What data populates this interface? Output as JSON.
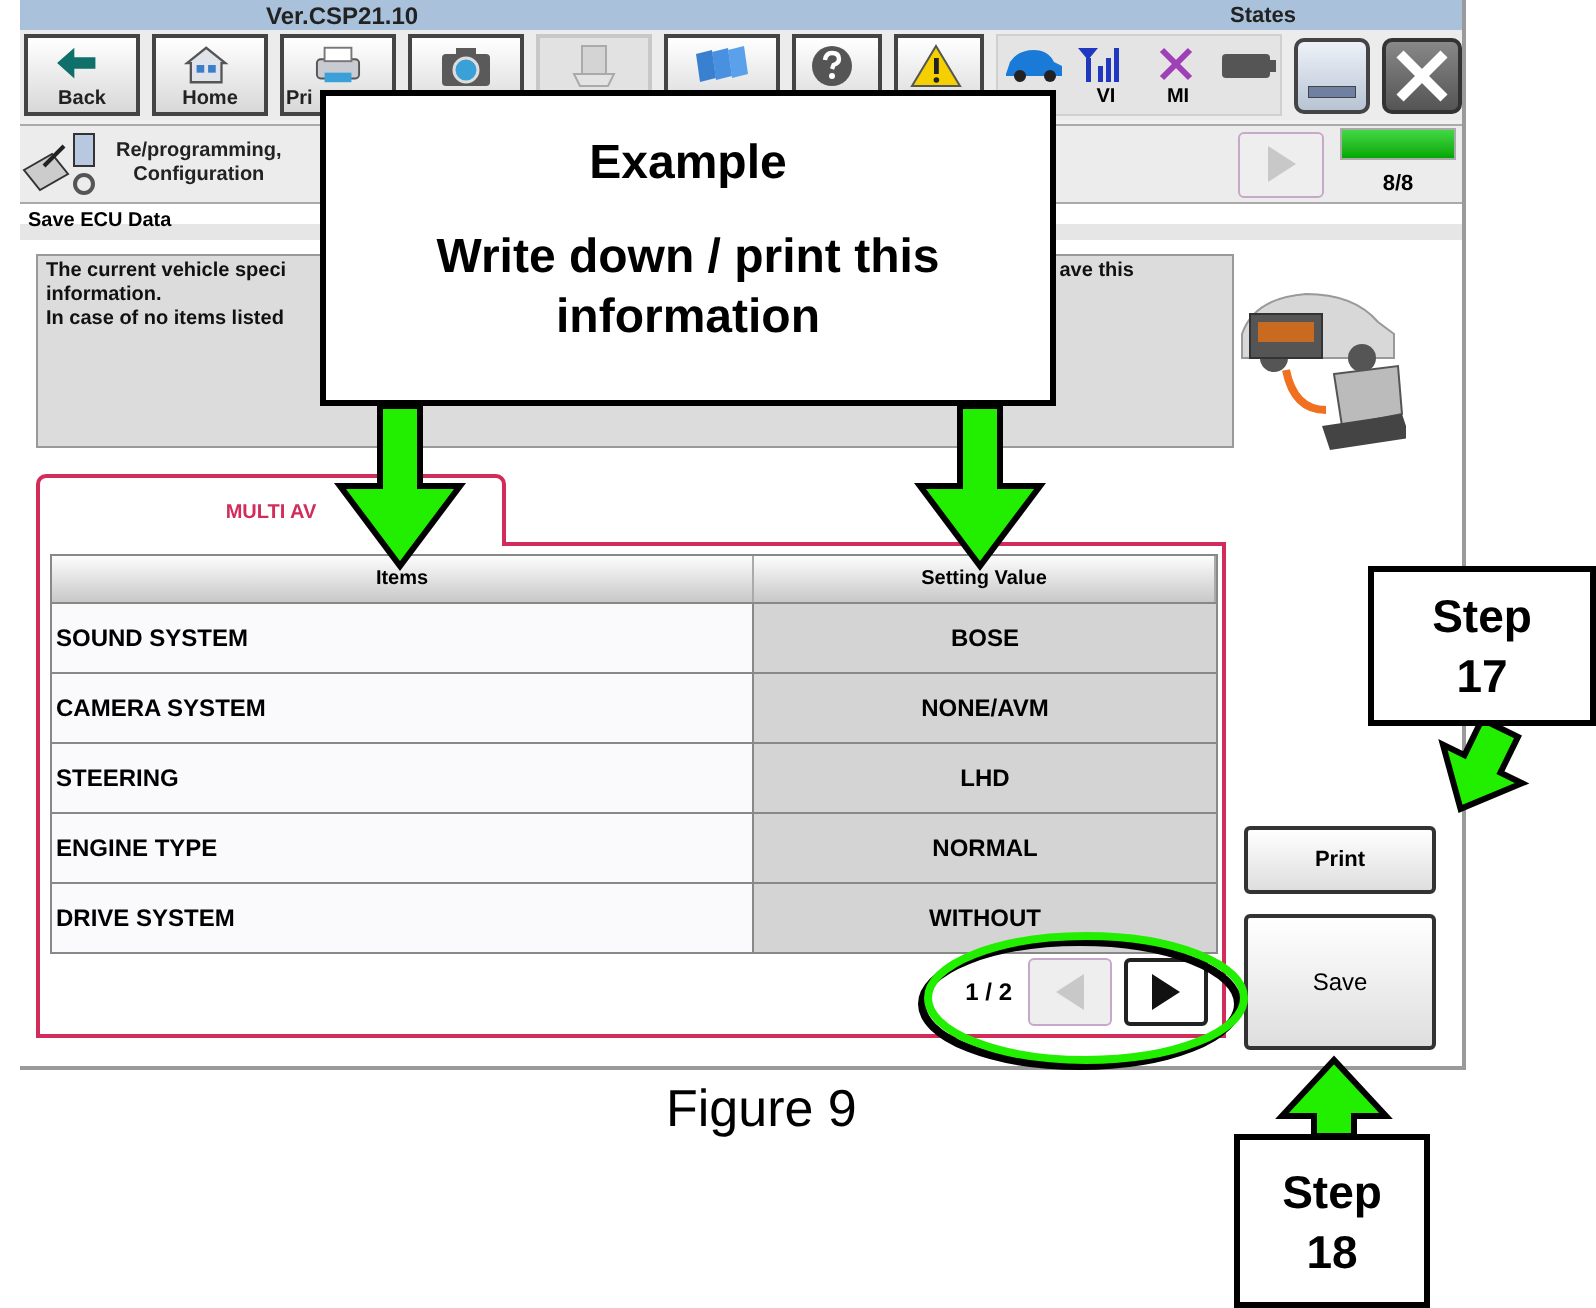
{
  "title_bar": {
    "version": "Ver.CSP21.10",
    "states_label": "States"
  },
  "toolbar": [
    {
      "kind": "back",
      "label": "Back",
      "disabled": false
    },
    {
      "kind": "home",
      "label": "Home",
      "disabled": false
    },
    {
      "kind": "print",
      "label": "Pri",
      "disabled": false
    },
    {
      "kind": "screen",
      "disabled": false
    },
    {
      "kind": "measurement",
      "disabled": true
    },
    {
      "kind": "recorded",
      "disabled": false
    },
    {
      "kind": "help",
      "disabled": false
    },
    {
      "kind": "dtc",
      "disabled": false
    }
  ],
  "states": [
    {
      "kind": "car"
    },
    {
      "kind": "vi",
      "label": "VI"
    },
    {
      "kind": "mi",
      "label": "MI"
    },
    {
      "kind": "battery"
    }
  ],
  "step_bar": {
    "label_lines": [
      "Re/programming,",
      "Configuration"
    ],
    "next_disabled": true,
    "progress": {
      "level": 1,
      "text": "8/8"
    }
  },
  "section_title": "Save ECU Data",
  "info_lines": [
    {
      "left": "The current vehicle speci",
      "right": "ave this"
    },
    {
      "left": "information."
    },
    {
      "left": "In case of no items listed"
    }
  ],
  "tabs": [
    {
      "label": "MULTI AV",
      "selected": true
    }
  ],
  "table": {
    "columns": [
      "Items",
      "Setting Value"
    ],
    "rows": [
      [
        "SOUND SYSTEM",
        "BOSE"
      ],
      [
        "CAMERA SYSTEM",
        "NONE/AVM"
      ],
      [
        "STEERING",
        "LHD"
      ],
      [
        "ENGINE TYPE",
        "NORMAL"
      ],
      [
        "DRIVE SYSTEM",
        "WITHOUT"
      ]
    ]
  },
  "pager": {
    "text": "1 / 2",
    "prev_disabled": true,
    "next_disabled": false
  },
  "buttons": [
    {
      "label": "Print"
    },
    {
      "label": "Save"
    }
  ],
  "callout": {
    "title": "Example",
    "text": "Write down / print this information"
  },
  "steps": [
    {
      "label": "Step 17"
    },
    {
      "label": "Step 18"
    }
  ],
  "caption": "Figure 9"
}
